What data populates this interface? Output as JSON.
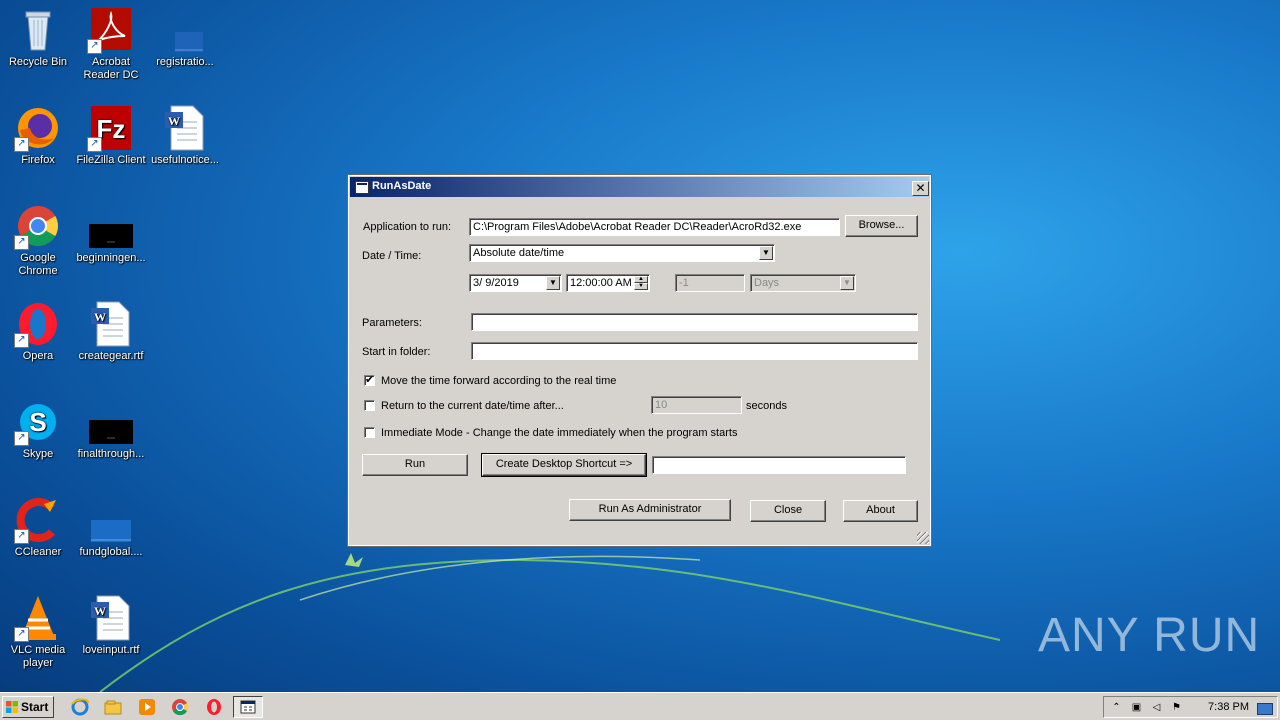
{
  "desktop": {
    "icons": [
      {
        "label": "Recycle Bin"
      },
      {
        "label": "Acrobat Reader DC"
      },
      {
        "label": "registratio..."
      },
      {
        "label": "Firefox"
      },
      {
        "label": "FileZilla Client"
      },
      {
        "label": "usefulnotice..."
      },
      {
        "label": "Google Chrome"
      },
      {
        "label": "beginningen..."
      },
      {
        "label": "Opera"
      },
      {
        "label": "creategear.rtf"
      },
      {
        "label": "Skype"
      },
      {
        "label": "finalthrough..."
      },
      {
        "label": "CCleaner"
      },
      {
        "label": "fundglobal...."
      },
      {
        "label": "VLC media player"
      },
      {
        "label": "loveinput.rtf"
      }
    ],
    "watermark": "ANY RUN"
  },
  "dialog": {
    "title": "RunAsDate",
    "close_glyph": "✕",
    "app_label": "Application to run:",
    "app_value": "C:\\Program Files\\Adobe\\Acrobat Reader DC\\Reader\\AcroRd32.exe",
    "browse_label": "Browse...",
    "datetime_label": "Date / Time:",
    "datetime_mode": "Absolute date/time",
    "date_value": "3/  9/2019",
    "time_value": "12:00:00 AM",
    "offset_value": "-1",
    "offset_unit": "Days",
    "params_label": "Parameters:",
    "params_value": "",
    "folder_label": "Start in folder:",
    "folder_value": "",
    "opt_forward_label": "Move the time forward according to the real time",
    "opt_forward_checked": true,
    "opt_return_label": "Return to the current date/time after...",
    "opt_return_checked": false,
    "return_seconds": "10",
    "seconds_label": "seconds",
    "opt_immediate_label": "Immediate Mode - Change the date immediately when the program starts",
    "opt_immediate_checked": false,
    "run_label": "Run",
    "shortcut_label": "Create Desktop Shortcut =>",
    "shortcut_value": "",
    "runadmin_label": "Run As Administrator",
    "close_label": "Close",
    "about_label": "About",
    "check_glyph": "✔"
  },
  "taskbar": {
    "start_label": "Start",
    "clock": "7:38 PM"
  },
  "colors": {
    "title_start": "#0a246a",
    "title_end": "#a6caf0",
    "dialog_bg": "#d6d3ce"
  }
}
